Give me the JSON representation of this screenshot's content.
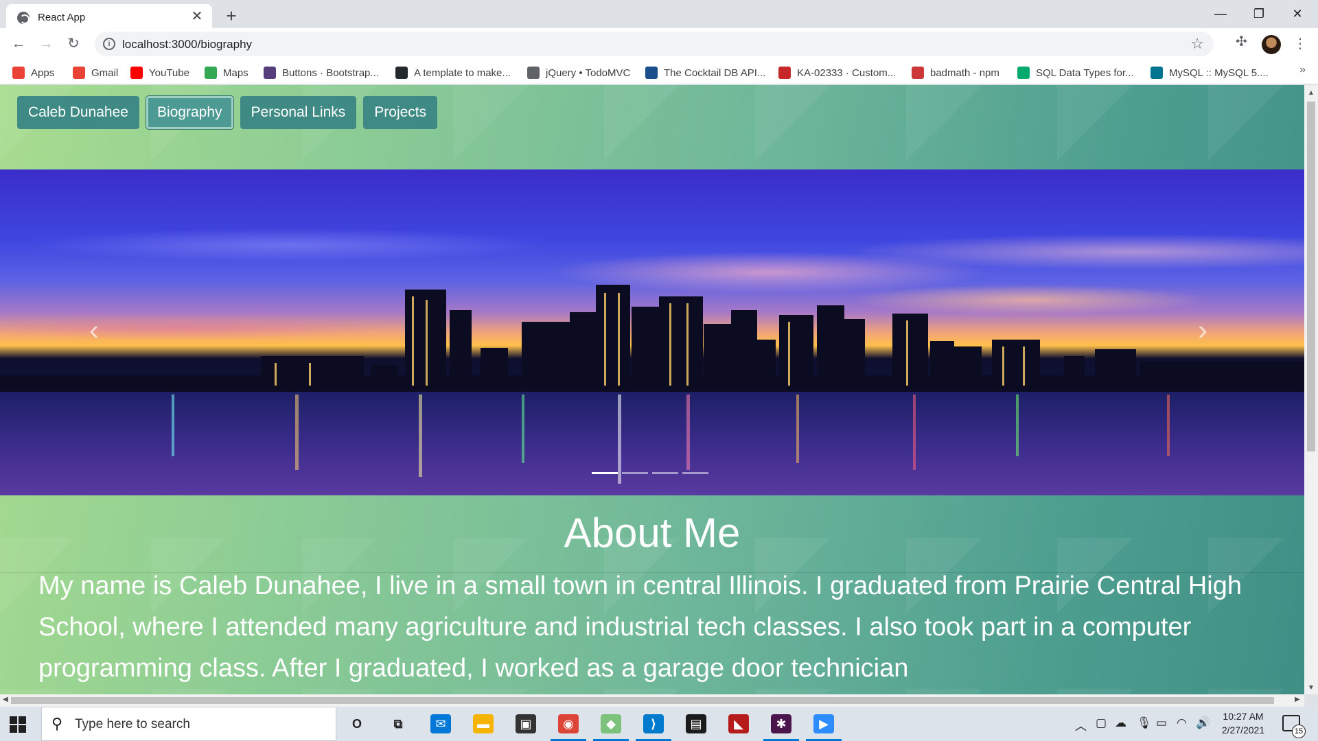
{
  "browser": {
    "tab_title": "React App",
    "close_glyph": "✕",
    "new_tab_glyph": "+",
    "url": "localhost:3000/biography",
    "window_controls": {
      "minimize": "—",
      "maximize": "❐",
      "close": "✕"
    },
    "nav": {
      "back": "←",
      "forward": "→",
      "reload": "↻"
    },
    "bookmarks": [
      {
        "label": "Apps",
        "icon": "apps-grid-icon",
        "color": "#ea4335"
      },
      {
        "label": "Gmail",
        "icon": "gmail-icon",
        "color": "#ea4335"
      },
      {
        "label": "YouTube",
        "icon": "youtube-icon",
        "color": "#ff0000"
      },
      {
        "label": "Maps",
        "icon": "maps-icon",
        "color": "#34a853"
      },
      {
        "label": "Buttons · Bootstrap...",
        "icon": "bootstrap-icon",
        "color": "#563d7c"
      },
      {
        "label": "A template to make...",
        "icon": "github-icon",
        "color": "#24292e"
      },
      {
        "label": "jQuery • TodoMVC",
        "icon": "globe-icon",
        "color": "#5f6368"
      },
      {
        "label": "The Cocktail DB API...",
        "icon": "cocktaildb-icon",
        "color": "#1a4f8b"
      },
      {
        "label": "KA-02333 · Custom...",
        "icon": "ssa-icon",
        "color": "#c62828"
      },
      {
        "label": "badmath - npm",
        "icon": "npm-icon",
        "color": "#cb3837"
      },
      {
        "label": "SQL Data Types for...",
        "icon": "w3schools-icon",
        "color": "#04aa6d"
      },
      {
        "label": "MySQL :: MySQL 5....",
        "icon": "mysql-icon",
        "color": "#00758f"
      }
    ],
    "more_glyph": "»"
  },
  "page": {
    "nav": [
      {
        "label": "Caleb Dunahee",
        "active": false
      },
      {
        "label": "Biography",
        "active": true
      },
      {
        "label": "Personal Links",
        "active": false
      },
      {
        "label": "Projects",
        "active": false
      }
    ],
    "carousel": {
      "prev_glyph": "‹",
      "next_glyph": "›",
      "slide_count": 4,
      "active_slide": 1
    },
    "about_title": "About Me",
    "bio": "My name is Caleb Dunahee, I live in a small town in central Illinois. I graduated from Prairie Central High School, where I attended many agriculture and industrial tech classes. I also took part in a computer programming class. After I graduated, I worked as a garage door technician"
  },
  "taskbar": {
    "search_placeholder": "Type here to search",
    "apps": [
      {
        "name": "cortana-icon",
        "glyph": "O",
        "color": "transparent",
        "running": false
      },
      {
        "name": "task-view-icon",
        "glyph": "⧉",
        "color": "transparent",
        "running": false
      },
      {
        "name": "mail-icon",
        "glyph": "✉",
        "color": "#0078d7",
        "running": false
      },
      {
        "name": "file-explorer-icon",
        "glyph": "▬",
        "color": "#f4b400",
        "running": false
      },
      {
        "name": "store-icon",
        "glyph": "▣",
        "color": "#333333",
        "running": false
      },
      {
        "name": "chrome-icon",
        "glyph": "◉",
        "color": "#db4437",
        "running": true
      },
      {
        "name": "git-icon",
        "glyph": "◆",
        "color": "#7cc27a",
        "running": true
      },
      {
        "name": "vscode-icon",
        "glyph": "⟩",
        "color": "#007acc",
        "running": true
      },
      {
        "name": "mysql-workbench-icon",
        "glyph": "▤",
        "color": "#1b1b1b",
        "running": false
      },
      {
        "name": "terminal-icon",
        "glyph": "◣",
        "color": "#b71c1c",
        "running": false
      },
      {
        "name": "slack-icon",
        "glyph": "✱",
        "color": "#4a154b",
        "running": true
      },
      {
        "name": "zoom-icon",
        "glyph": "▶",
        "color": "#2d8cff",
        "running": true
      }
    ],
    "time": "10:27 AM",
    "date": "2/27/2021",
    "notification_count": "15"
  }
}
